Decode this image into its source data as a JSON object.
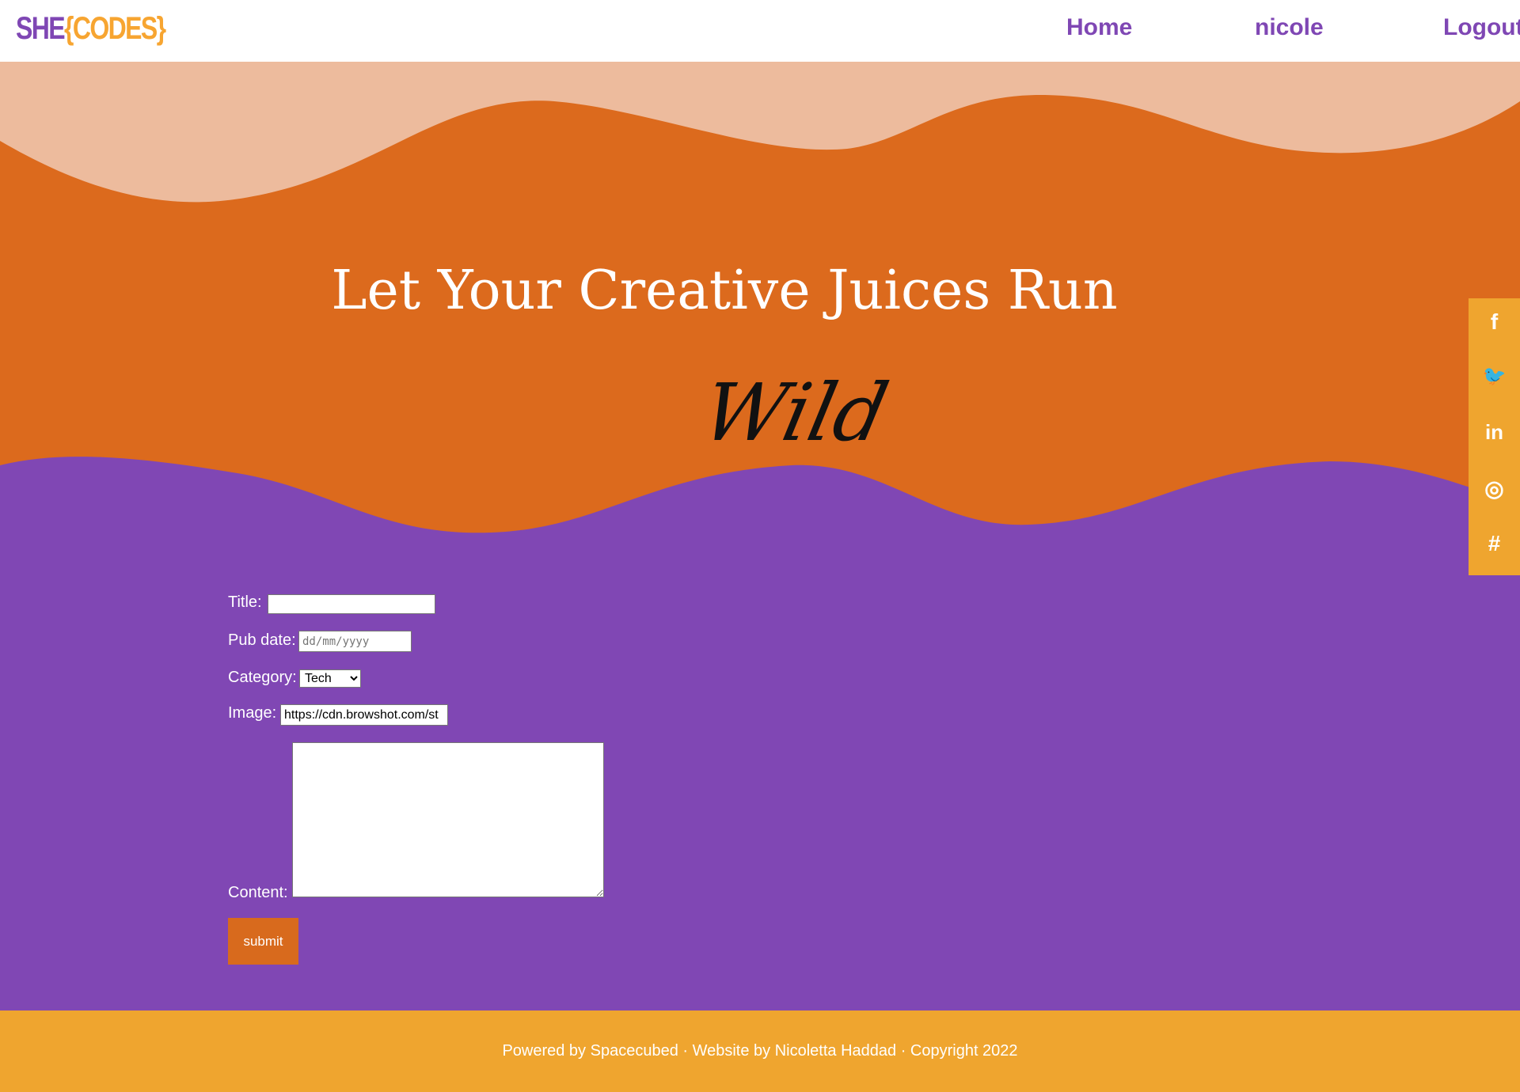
{
  "header": {
    "logo": {
      "part1": "SHE",
      "part2": "{CODES}"
    },
    "nav": [
      {
        "label": "Home"
      },
      {
        "label": "nicole"
      },
      {
        "label": "Logout"
      }
    ]
  },
  "hero": {
    "title": "Let Your Creative Juices Run",
    "script": "Wild",
    "colors": {
      "peach": "#edbb9d",
      "orange": "#dc6a1d",
      "purple": "#8047b4"
    }
  },
  "social": [
    {
      "icon": "facebook-icon",
      "glyph": "f"
    },
    {
      "icon": "twitter-icon",
      "glyph": "🐦"
    },
    {
      "icon": "linkedin-icon",
      "glyph": "in"
    },
    {
      "icon": "instagram-icon",
      "glyph": "◎"
    },
    {
      "icon": "slack-icon",
      "glyph": "#"
    }
  ],
  "form": {
    "title_label": "Title:",
    "title_value": "",
    "pubdate_label": "Pub date:",
    "pubdate_placeholder": "dd/mm/yyyy",
    "category_label": "Category:",
    "category_value": "Tech",
    "image_label": "Image:",
    "image_value": "https://cdn.browshot.com/st",
    "content_label": "Content:",
    "content_value": "",
    "submit_label": "submit"
  },
  "footer": {
    "text": "Powered by Spacecubed · Website by Nicoletta Haddad · Copyright 2022"
  }
}
